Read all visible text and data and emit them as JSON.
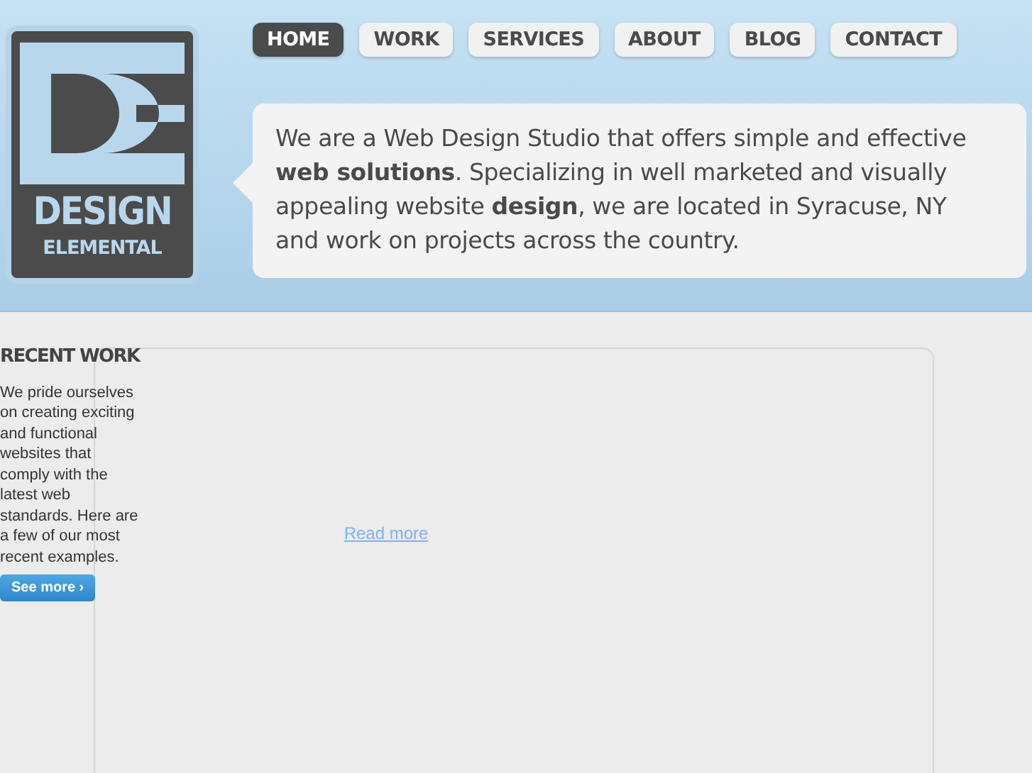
{
  "logo": {
    "line_1": "DESIGN",
    "line_2": "ELEMENTAL"
  },
  "nav": [
    {
      "label": "HOME",
      "selected": true
    },
    {
      "label": "WORK",
      "selected": false
    },
    {
      "label": "SERVICES",
      "selected": false
    },
    {
      "label": "ABOUT",
      "selected": false
    },
    {
      "label": "BLOG",
      "selected": false
    },
    {
      "label": "CONTACT",
      "selected": false
    }
  ],
  "intro": "We are a Web Design Studio that offers simple and effective **web solutions**. Specializing in well marketed and visually appealing website **design**, we are located in Syracuse, NY and work on projects across the country.",
  "recent_work": {
    "heading": "RECENT WORK",
    "text": "We pride ourselves on creating exciting and functional websites that comply with the latest web standards. Here are a few of our most recent examples.",
    "button": "See more ›"
  },
  "showcase": {
    "link": "Read more"
  }
}
